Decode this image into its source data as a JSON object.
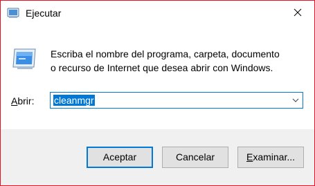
{
  "window": {
    "title": "Ejecutar",
    "title_icon": "run-icon",
    "close_icon": "close-icon"
  },
  "dialog": {
    "icon": "run-program-icon",
    "description_line1": "Escriba el nombre del programa, carpeta, documento",
    "description_line2": "o recurso de Internet que desea abrir con Windows.",
    "open_label_accel": "A",
    "open_label_rest": "brir:",
    "open_value": "cleanmgr",
    "dropdown_icon": "chevron-down-icon"
  },
  "buttons": {
    "accept": "Aceptar",
    "cancel": "Cancelar",
    "browse_accel": "E",
    "browse_rest": "xaminar..."
  },
  "colors": {
    "accent": "#0078d7",
    "border_active": "#e81123",
    "footer_bg": "#f0f0f0"
  }
}
